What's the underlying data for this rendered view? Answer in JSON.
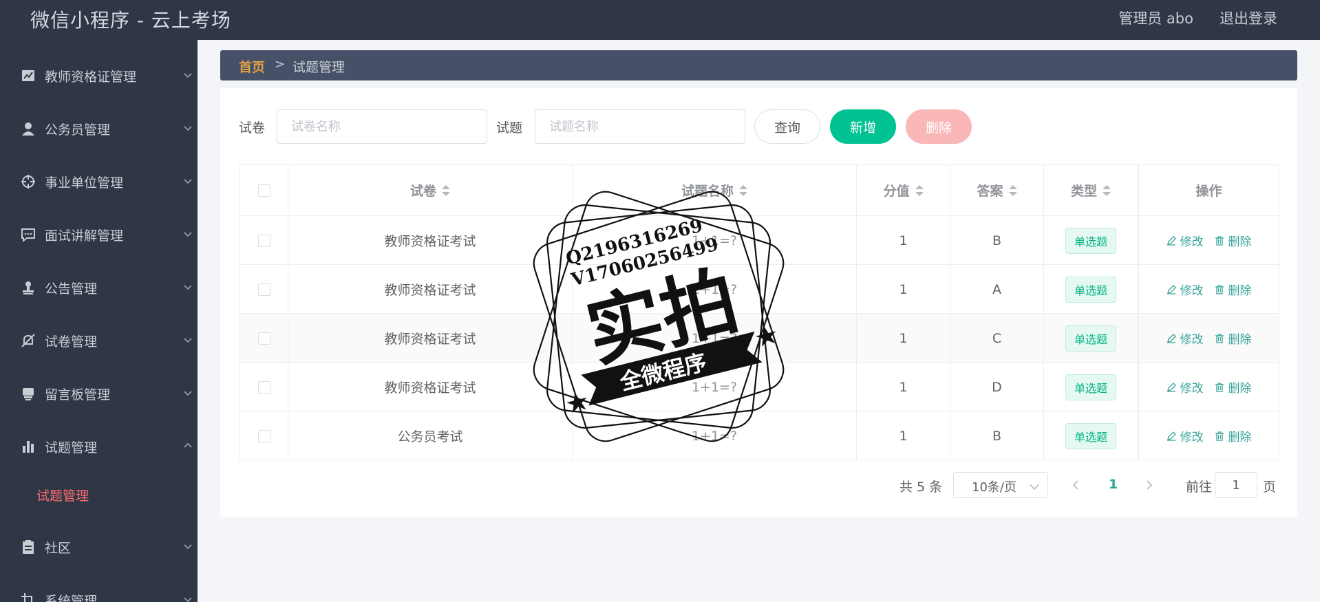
{
  "header": {
    "title": "微信小程序 - 云上考场",
    "user": "管理员 abo",
    "logout": "退出登录"
  },
  "sidebar": {
    "items": [
      {
        "label": "教师资格证管理",
        "icon": "chart-icon"
      },
      {
        "label": "公务员管理",
        "icon": "person-icon"
      },
      {
        "label": "事业单位管理",
        "icon": "crosshair-icon"
      },
      {
        "label": "面试讲解管理",
        "icon": "chat-icon"
      },
      {
        "label": "公告管理",
        "icon": "stamp-icon"
      },
      {
        "label": "试卷管理",
        "icon": "bell-off-icon"
      },
      {
        "label": "留言板管理",
        "icon": "printer-icon"
      },
      {
        "label": "试题管理",
        "icon": "bar-chart-icon"
      },
      {
        "label": "社区",
        "icon": "clipboard-icon"
      },
      {
        "label": "系统管理",
        "icon": "crop-icon"
      }
    ],
    "active_sub": "试题管理"
  },
  "breadcrumb": {
    "home": "首页",
    "sep": ">",
    "current": "试题管理"
  },
  "search": {
    "paper_label": "试卷",
    "paper_placeholder": "试卷名称",
    "question_label": "试题",
    "question_placeholder": "试题名称",
    "query": "查询",
    "add": "新增",
    "delete": "删除"
  },
  "table": {
    "columns": [
      "试卷",
      "试题名称",
      "分值",
      "答案",
      "类型",
      "操作"
    ],
    "rows": [
      {
        "paper": "教师资格证考试",
        "question": "1+1=?",
        "score": "1",
        "answer": "B",
        "type": "单选题"
      },
      {
        "paper": "教师资格证考试",
        "question": "1+1=?",
        "score": "1",
        "answer": "A",
        "type": "单选题"
      },
      {
        "paper": "教师资格证考试",
        "question": "1+1=?",
        "score": "1",
        "answer": "C",
        "type": "单选题"
      },
      {
        "paper": "教师资格证考试",
        "question": "1+1=?",
        "score": "1",
        "answer": "D",
        "type": "单选题"
      },
      {
        "paper": "公务员考试",
        "question": "1+1=?",
        "score": "1",
        "answer": "B",
        "type": "单选题"
      }
    ],
    "edit": "修改",
    "remove": "删除"
  },
  "pagination": {
    "total": "共 5 条",
    "size": "10条/页",
    "current": "1",
    "goto": "前往",
    "goto_value": "1",
    "page": "页"
  },
  "stamp": {
    "line1": "Q2196316269",
    "line2": "V17060256499",
    "main": "实拍",
    "ribbon": "全微程序"
  },
  "colors": {
    "sidebar": "#2f3747",
    "accent": "#00c292",
    "danger": "#f9b7b7",
    "home": "#e5a145",
    "active": "#ff6b6b"
  }
}
